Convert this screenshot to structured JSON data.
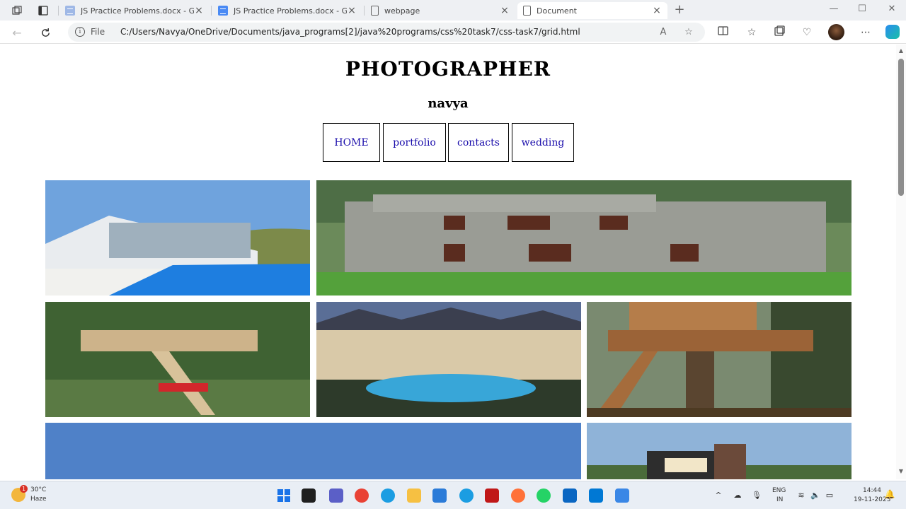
{
  "browser": {
    "tabs": [
      {
        "title": "JS Practice Problems.docx - Goo",
        "favicon": "google-docs-icon",
        "active": false
      },
      {
        "title": "JS Practice Problems.docx - Goo",
        "favicon": "google-docs-icon",
        "active": false
      },
      {
        "title": "webpage",
        "favicon": "page-icon",
        "active": false
      },
      {
        "title": "Document",
        "favicon": "page-icon",
        "active": true
      }
    ],
    "new_tab": "+",
    "minimize": "—",
    "maximize": "☐",
    "close": "✕",
    "address": {
      "scheme_label": "File",
      "url": "C:/Users/Navya/OneDrive/Documents/java_programs[2]/java%20programs/css%20task7/css-task7/grid.html"
    }
  },
  "page": {
    "title": "PHOTOGRAPHER",
    "subtitle": "navya",
    "nav": [
      "HOME",
      "portfolio",
      "contacts",
      "wedding"
    ]
  },
  "taskbar": {
    "weather": {
      "badge": "1",
      "temp": "30°C",
      "condition": "Haze"
    },
    "lang": [
      "ENG",
      "IN"
    ],
    "time": "14:44",
    "date": "19-11-2023",
    "colors": {
      "windows": "#1a73e8",
      "files": "#f6c042",
      "teams": "#5b5fc7",
      "chrome": "#e94235",
      "edge": "#1b9de2",
      "store": "#2b7bd8",
      "mcafee": "#c01818",
      "firefox": "#ff7139",
      "whatsapp": "#25d366",
      "linkedin": "#0a66c2",
      "vscode": "#0078d4",
      "snipping": "#3a87e6"
    }
  }
}
